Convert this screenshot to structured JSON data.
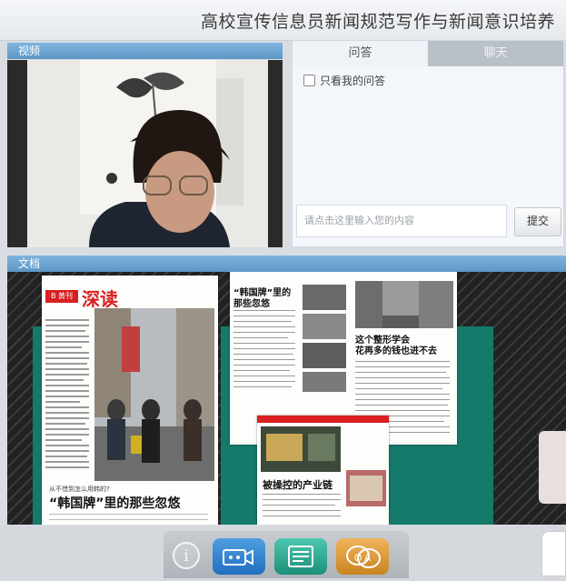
{
  "window": {
    "title": "高校宣传信息员新闻规范写作与新闻意识培养"
  },
  "video_panel": {
    "label": "视频"
  },
  "qa_panel": {
    "tabs": [
      {
        "label": "问答",
        "active": true
      },
      {
        "label": "聊天",
        "active": false
      }
    ],
    "only_mine_label": "只看我的问答",
    "input_placeholder": "请点击这里输入您的内容",
    "submit_label": "提交"
  },
  "doc_panel": {
    "label": "文档",
    "left_page": {
      "masthead": "深读",
      "badge": "B 黄刊",
      "question": "从不惜到怎么用韩的?",
      "headline": "“韩国牌”里的那些忽悠"
    },
    "right_page": {
      "top_headline_1": "“韩国牌”里的",
      "top_headline_2": "那些忽悠",
      "mid_headline_1": "这个整形学会",
      "mid_headline_2": "花再多的钱也进不去",
      "bottom_headline": "被操控的产业链"
    }
  },
  "toolbar": {
    "info_icon": "info-icon",
    "camera_icon": "camera-icon",
    "document_icon": "document-icon",
    "qa_icon": "qa-icon",
    "qa_icon_text": "Q A",
    "info_glyph": "i"
  }
}
